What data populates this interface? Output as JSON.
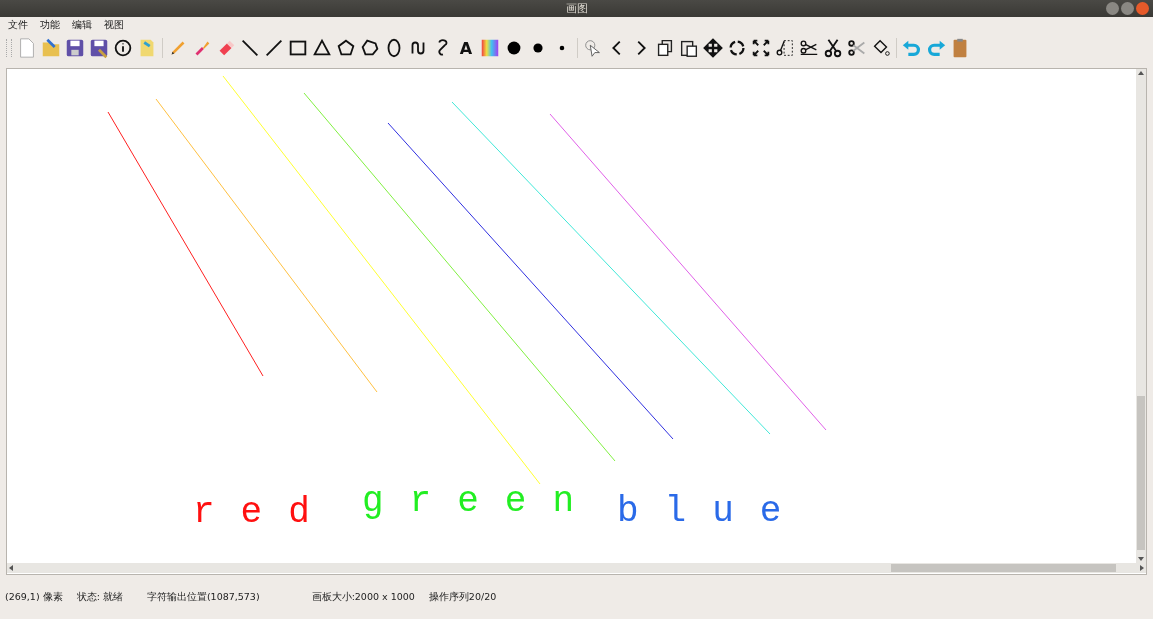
{
  "window": {
    "title": "画图"
  },
  "menu": [
    "文件",
    "功能",
    "编辑",
    "视图"
  ],
  "toolbar": {
    "text_tool_label": "A"
  },
  "canvas": {
    "lines": [
      {
        "color": "#ff2020"
      },
      {
        "color": "#ffc040"
      },
      {
        "color": "#ffff30"
      },
      {
        "color": "#80f040"
      },
      {
        "color": "#3030e0"
      },
      {
        "color": "#40e8d8"
      },
      {
        "color": "#e060e8"
      }
    ],
    "texts": [
      {
        "text": "red",
        "color": "#ff1010"
      },
      {
        "text": "green",
        "color": "#22ee22"
      },
      {
        "text": "blue",
        "color": "#2a6ae8"
      }
    ]
  },
  "status_bar": [
    "(269,1) 像素",
    "状态: 就绪",
    "字符输出位置(1087,573)",
    "画板大小:2000 x 1000",
    "操作序列20/20"
  ]
}
